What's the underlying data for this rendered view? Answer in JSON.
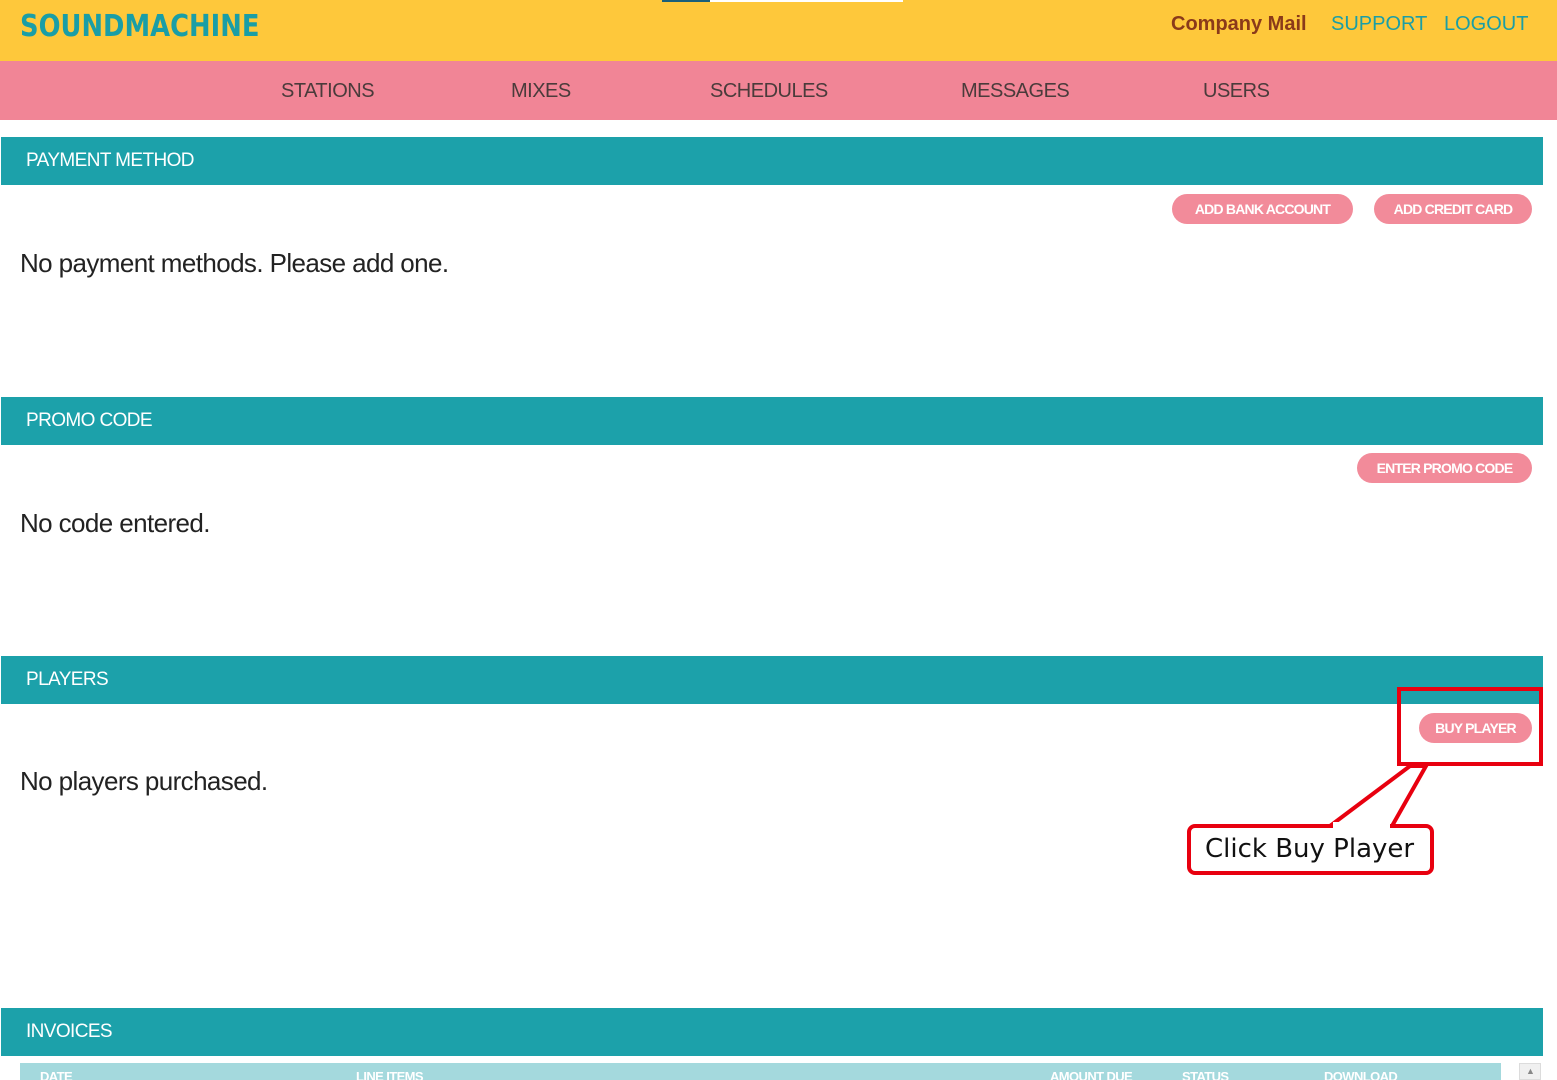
{
  "app": {
    "logo": "SOUNDMACHINE",
    "links": {
      "company": "Company Mail",
      "support": "SUPPORT",
      "logout": "LOGOUT"
    }
  },
  "nav": {
    "items": [
      "STATIONS",
      "MIXES",
      "SCHEDULES",
      "MESSAGES",
      "USERS"
    ]
  },
  "sections": {
    "payment": {
      "title": "PAYMENT METHOD",
      "add_bank_label": "ADD BANK ACCOUNT",
      "add_card_label": "ADD CREDIT CARD",
      "empty_message": "No payment methods. Please add one."
    },
    "promo": {
      "title": "PROMO CODE",
      "enter_label": "ENTER PROMO CODE",
      "empty_message": "No code entered."
    },
    "players": {
      "title": "PLAYERS",
      "buy_label": "BUY PLAYER",
      "empty_message": "No players purchased."
    },
    "invoices": {
      "title": "INVOICES",
      "columns": [
        "DATE",
        "LINE ITEMS",
        "AMOUNT DUE",
        "STATUS",
        "DOWNLOAD"
      ]
    }
  },
  "annotation": {
    "callout_text": "Click Buy Player"
  },
  "colors": {
    "topbar": "#fec83b",
    "navbar": "#f18596",
    "section_header": "#1ca1aa",
    "pill_button": "#f28b9a",
    "annotation_red": "#e8000f"
  },
  "icons": {
    "scroll_up": "triangle-up"
  }
}
